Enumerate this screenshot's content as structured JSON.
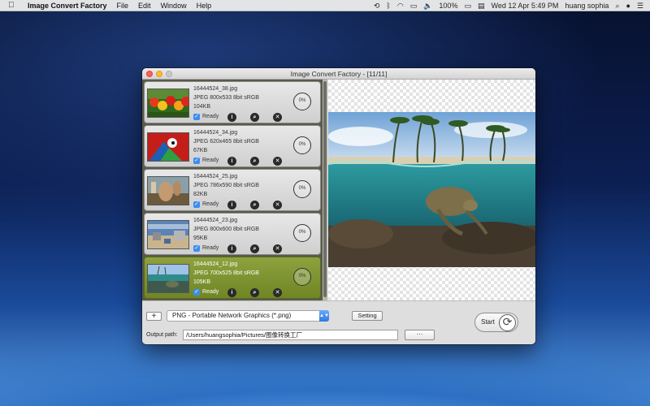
{
  "menubar": {
    "app_name": "Image Convert Factory",
    "menus": [
      "File",
      "Edit",
      "Window",
      "Help"
    ],
    "battery": "100%",
    "datetime": "Wed 12 Apr  5:49 PM",
    "user": "huang sophia"
  },
  "window": {
    "title": "Image Convert Factory - [11/11]"
  },
  "files": [
    {
      "name": "16444524_38.jpg",
      "format": "JPEG 800x533 8bit sRGB",
      "size": "104KB",
      "status": "Ready",
      "progress": "0%"
    },
    {
      "name": "16444524_34.jpg",
      "format": "JPEG 620x465 8bit sRGB",
      "size": "67KB",
      "status": "Ready",
      "progress": "0%"
    },
    {
      "name": "16444524_25.jpg",
      "format": "JPEG 786x590 8bit sRGB",
      "size": "82KB",
      "status": "Ready",
      "progress": "0%"
    },
    {
      "name": "16444524_23.jpg",
      "format": "JPEG 800x600 8bit sRGB",
      "size": "95KB",
      "status": "Ready",
      "progress": "0%"
    },
    {
      "name": "16444524_12.jpg",
      "format": "JPEG 700x525 8bit sRGB",
      "size": "105KB",
      "status": "Ready",
      "progress": "0%"
    }
  ],
  "controls": {
    "add_label": "+",
    "format_selected": "PNG - Portable Network Graphics (*.png)",
    "setting_label": "Setting",
    "output_label": "Output path:",
    "output_path": "/Users/huangsophia/Pictures/图像转换工厂",
    "browse_label": "···",
    "start_label": "Start"
  },
  "icons": {
    "apple": "apple-icon",
    "info": "info-icon",
    "zoom": "magnifier-icon",
    "remove": "remove-icon",
    "convert": "refresh-icon"
  },
  "colors": {
    "selected_row": "#7a8f2c",
    "accent_blue": "#3b8df0"
  }
}
